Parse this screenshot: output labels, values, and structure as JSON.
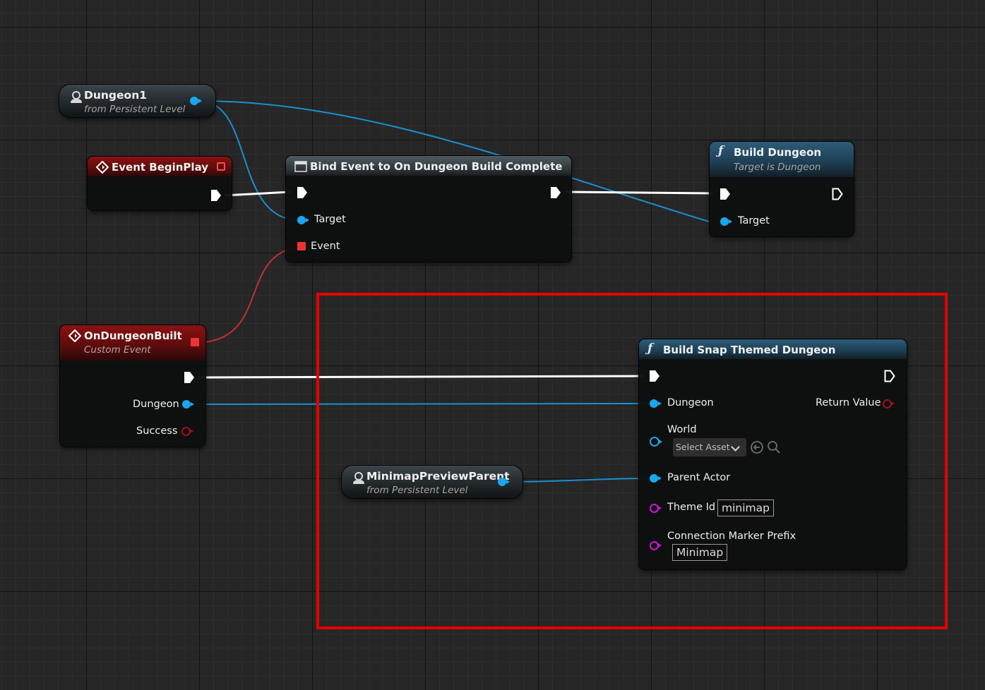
{
  "graph": {
    "colors": {
      "exec": "#ffffff",
      "object": "#19a7ee",
      "delegate": "#ef3232",
      "string": "#d614d6",
      "bool": "#9e0f20",
      "highlight": "#e60000"
    },
    "nodes": {
      "dungeon1": {
        "title": "Dungeon1",
        "subtitle": "from Persistent Level",
        "icon": "actor-reference-icon"
      },
      "begin_play": {
        "title": "Event BeginPlay",
        "icon": "event-diamond-icon"
      },
      "bind_event": {
        "title": "Bind Event to On Dungeon Build Complete",
        "icon": "bind-event-icon",
        "pins": {
          "target": "Target",
          "event": "Event"
        }
      },
      "build_dungeon": {
        "title": "Build Dungeon",
        "subtitle": "Target is Dungeon",
        "icon": "function-icon",
        "pins": {
          "target": "Target"
        }
      },
      "on_dungeon_built": {
        "title": "OnDungeonBuilt",
        "subtitle": "Custom Event",
        "icon": "event-diamond-icon",
        "pins": {
          "dungeon": "Dungeon",
          "success": "Success"
        }
      },
      "minimap_parent": {
        "title": "MinimapPreviewParent",
        "subtitle": "from Persistent Level",
        "icon": "actor-reference-icon"
      },
      "build_snap": {
        "title": "Build Snap Themed Dungeon",
        "icon": "function-icon",
        "pins": {
          "dungeon": "Dungeon",
          "return_value": "Return Value",
          "world": "World",
          "parent_actor": "Parent Actor",
          "theme_id": "Theme Id",
          "connection_marker_prefix": "Connection Marker Prefix"
        },
        "world_select": "Select Asset",
        "theme_id_value": "minimap",
        "connection_marker_prefix_value": "Minimap"
      }
    }
  }
}
